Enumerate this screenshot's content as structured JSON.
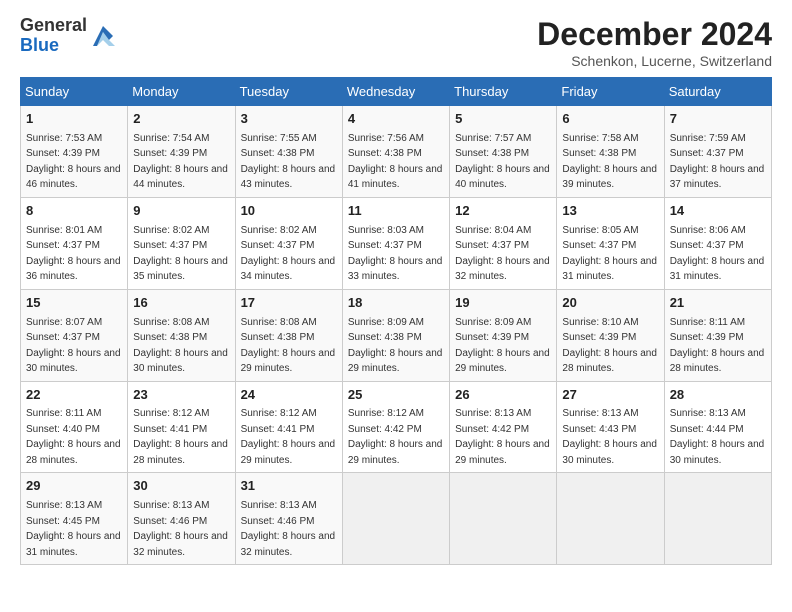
{
  "header": {
    "logo_general": "General",
    "logo_blue": "Blue",
    "month_title": "December 2024",
    "location": "Schenkon, Lucerne, Switzerland"
  },
  "days_of_week": [
    "Sunday",
    "Monday",
    "Tuesday",
    "Wednesday",
    "Thursday",
    "Friday",
    "Saturday"
  ],
  "weeks": [
    [
      {
        "day": "1",
        "sunrise": "7:53 AM",
        "sunset": "4:39 PM",
        "daylight": "8 hours and 46 minutes."
      },
      {
        "day": "2",
        "sunrise": "7:54 AM",
        "sunset": "4:39 PM",
        "daylight": "8 hours and 44 minutes."
      },
      {
        "day": "3",
        "sunrise": "7:55 AM",
        "sunset": "4:38 PM",
        "daylight": "8 hours and 43 minutes."
      },
      {
        "day": "4",
        "sunrise": "7:56 AM",
        "sunset": "4:38 PM",
        "daylight": "8 hours and 41 minutes."
      },
      {
        "day": "5",
        "sunrise": "7:57 AM",
        "sunset": "4:38 PM",
        "daylight": "8 hours and 40 minutes."
      },
      {
        "day": "6",
        "sunrise": "7:58 AM",
        "sunset": "4:38 PM",
        "daylight": "8 hours and 39 minutes."
      },
      {
        "day": "7",
        "sunrise": "7:59 AM",
        "sunset": "4:37 PM",
        "daylight": "8 hours and 37 minutes."
      }
    ],
    [
      {
        "day": "8",
        "sunrise": "8:01 AM",
        "sunset": "4:37 PM",
        "daylight": "8 hours and 36 minutes."
      },
      {
        "day": "9",
        "sunrise": "8:02 AM",
        "sunset": "4:37 PM",
        "daylight": "8 hours and 35 minutes."
      },
      {
        "day": "10",
        "sunrise": "8:02 AM",
        "sunset": "4:37 PM",
        "daylight": "8 hours and 34 minutes."
      },
      {
        "day": "11",
        "sunrise": "8:03 AM",
        "sunset": "4:37 PM",
        "daylight": "8 hours and 33 minutes."
      },
      {
        "day": "12",
        "sunrise": "8:04 AM",
        "sunset": "4:37 PM",
        "daylight": "8 hours and 32 minutes."
      },
      {
        "day": "13",
        "sunrise": "8:05 AM",
        "sunset": "4:37 PM",
        "daylight": "8 hours and 31 minutes."
      },
      {
        "day": "14",
        "sunrise": "8:06 AM",
        "sunset": "4:37 PM",
        "daylight": "8 hours and 31 minutes."
      }
    ],
    [
      {
        "day": "15",
        "sunrise": "8:07 AM",
        "sunset": "4:37 PM",
        "daylight": "8 hours and 30 minutes."
      },
      {
        "day": "16",
        "sunrise": "8:08 AM",
        "sunset": "4:38 PM",
        "daylight": "8 hours and 30 minutes."
      },
      {
        "day": "17",
        "sunrise": "8:08 AM",
        "sunset": "4:38 PM",
        "daylight": "8 hours and 29 minutes."
      },
      {
        "day": "18",
        "sunrise": "8:09 AM",
        "sunset": "4:38 PM",
        "daylight": "8 hours and 29 minutes."
      },
      {
        "day": "19",
        "sunrise": "8:09 AM",
        "sunset": "4:39 PM",
        "daylight": "8 hours and 29 minutes."
      },
      {
        "day": "20",
        "sunrise": "8:10 AM",
        "sunset": "4:39 PM",
        "daylight": "8 hours and 28 minutes."
      },
      {
        "day": "21",
        "sunrise": "8:11 AM",
        "sunset": "4:39 PM",
        "daylight": "8 hours and 28 minutes."
      }
    ],
    [
      {
        "day": "22",
        "sunrise": "8:11 AM",
        "sunset": "4:40 PM",
        "daylight": "8 hours and 28 minutes."
      },
      {
        "day": "23",
        "sunrise": "8:12 AM",
        "sunset": "4:41 PM",
        "daylight": "8 hours and 28 minutes."
      },
      {
        "day": "24",
        "sunrise": "8:12 AM",
        "sunset": "4:41 PM",
        "daylight": "8 hours and 29 minutes."
      },
      {
        "day": "25",
        "sunrise": "8:12 AM",
        "sunset": "4:42 PM",
        "daylight": "8 hours and 29 minutes."
      },
      {
        "day": "26",
        "sunrise": "8:13 AM",
        "sunset": "4:42 PM",
        "daylight": "8 hours and 29 minutes."
      },
      {
        "day": "27",
        "sunrise": "8:13 AM",
        "sunset": "4:43 PM",
        "daylight": "8 hours and 30 minutes."
      },
      {
        "day": "28",
        "sunrise": "8:13 AM",
        "sunset": "4:44 PM",
        "daylight": "8 hours and 30 minutes."
      }
    ],
    [
      {
        "day": "29",
        "sunrise": "8:13 AM",
        "sunset": "4:45 PM",
        "daylight": "8 hours and 31 minutes."
      },
      {
        "day": "30",
        "sunrise": "8:13 AM",
        "sunset": "4:46 PM",
        "daylight": "8 hours and 32 minutes."
      },
      {
        "day": "31",
        "sunrise": "8:13 AM",
        "sunset": "4:46 PM",
        "daylight": "8 hours and 32 minutes."
      },
      null,
      null,
      null,
      null
    ]
  ]
}
